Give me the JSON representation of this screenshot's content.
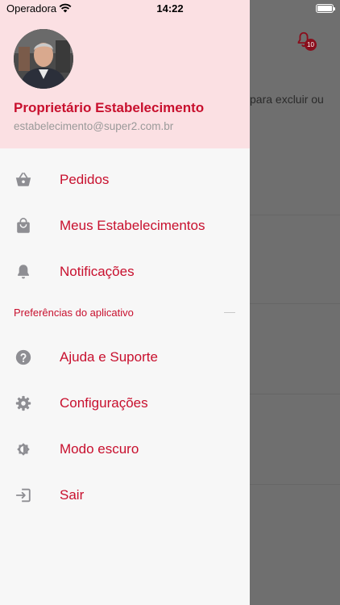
{
  "status_bar": {
    "carrier": "Operadora",
    "time": "14:22"
  },
  "background": {
    "notification_count": "10",
    "hint_text": "para excluir ou"
  },
  "drawer": {
    "user": {
      "name": "Proprietário Estabelecimento",
      "email": "estabelecimento@super2.com.br"
    },
    "primary_items": [
      {
        "label": "Pedidos",
        "icon": "basket-icon"
      },
      {
        "label": "Meus Estabelecimentos",
        "icon": "shopping-bag-icon"
      },
      {
        "label": "Notificações",
        "icon": "bell-icon"
      }
    ],
    "section_title": "Preferências do aplicativo",
    "secondary_items": [
      {
        "label": "Ajuda e Suporte",
        "icon": "help-icon"
      },
      {
        "label": "Configurações",
        "icon": "gear-icon"
      },
      {
        "label": "Modo escuro",
        "icon": "brightness-icon"
      },
      {
        "label": "Sair",
        "icon": "logout-icon"
      }
    ]
  },
  "colors": {
    "accent": "#c8102e",
    "header_bg": "#fbe0e3",
    "icon_gray": "#8e8e93"
  }
}
